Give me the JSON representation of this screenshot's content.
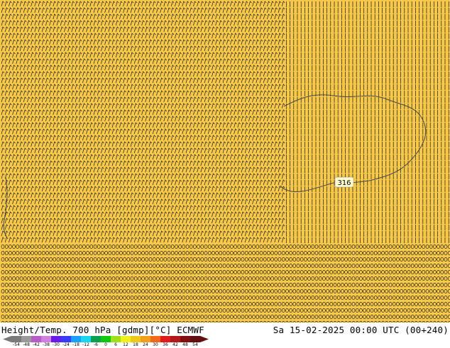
{
  "map": {
    "background_color": "#f7c84a",
    "barb_color": "#1a1a1a",
    "coast_color": "#4a4a4a",
    "contour_label": "316",
    "contour_label_bg": "#ffffd0"
  },
  "footer": {
    "title_left": "Height/Temp. 700 hPa [gdmp][°C] ECMWF",
    "title_right": "Sa 15-02-2025 00:00 UTC (00+240)"
  },
  "colorbar": {
    "ticks": [
      "-54",
      "-48",
      "-42",
      "-38",
      "-30",
      "-24",
      "-18",
      "-12",
      "-6",
      "0",
      "6",
      "12",
      "18",
      "24",
      "30",
      "36",
      "42",
      "48",
      "54"
    ],
    "colors": [
      "#7a7a7a",
      "#9a9a9a",
      "#b85cc8",
      "#d07ee0",
      "#6a1ae8",
      "#3a3aff",
      "#1aa0ff",
      "#1ad4f0",
      "#0aa050",
      "#10c810",
      "#a0e01a",
      "#f0f01a",
      "#f0c81a",
      "#f0a01a",
      "#f06a1a",
      "#e01a1a",
      "#b01a1a",
      "#801010",
      "#601010"
    ]
  }
}
